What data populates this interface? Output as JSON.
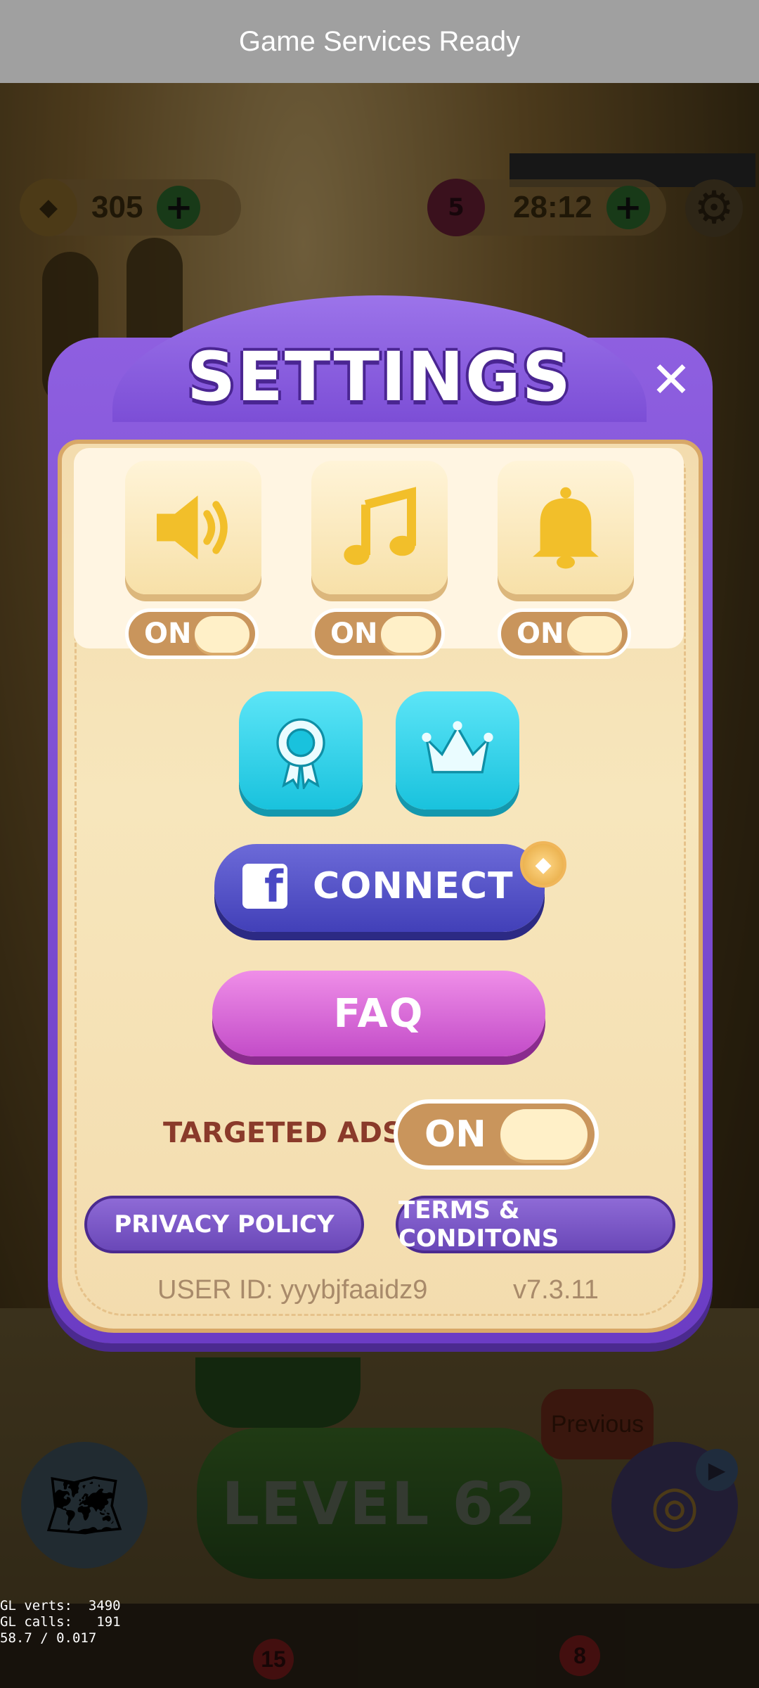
{
  "status_bar": {
    "message": "Game Services Ready"
  },
  "hud": {
    "coins": "305",
    "lives": "5",
    "timer": "28:12"
  },
  "settings": {
    "title": "SETTINGS",
    "toggles": [
      {
        "icon": "speaker-icon",
        "state": "ON"
      },
      {
        "icon": "music-note-icon",
        "state": "ON"
      },
      {
        "icon": "bell-icon",
        "state": "ON"
      }
    ],
    "connect_label": "CONNECT",
    "faq_label": "FAQ",
    "targeted_ads_label": "TARGETED ADS:",
    "targeted_ads_state": "ON",
    "privacy_label": "PRIVACY POLICY",
    "terms_label": "TERMS & CONDITONS",
    "user_id": "USER ID: yyybjfaaidz9",
    "version": "v7.3.11"
  },
  "game": {
    "level_label": "LEVEL 62",
    "previous_label": "Previous",
    "badges": [
      "15",
      "8"
    ]
  },
  "debug": {
    "line1": "GL verts:  3490",
    "line2": "GL calls:   191",
    "line3": "58.7 / 0.017"
  },
  "colors": {
    "panel_purple": "#7c4ed6",
    "panel_cream": "#f7e6bc",
    "toggle_tan": "#c9955c",
    "cyan_button": "#19c2dd",
    "facebook_blue": "#4240b8",
    "faq_pink": "#c34cc8",
    "icon_yellow": "#f2bf2a"
  }
}
